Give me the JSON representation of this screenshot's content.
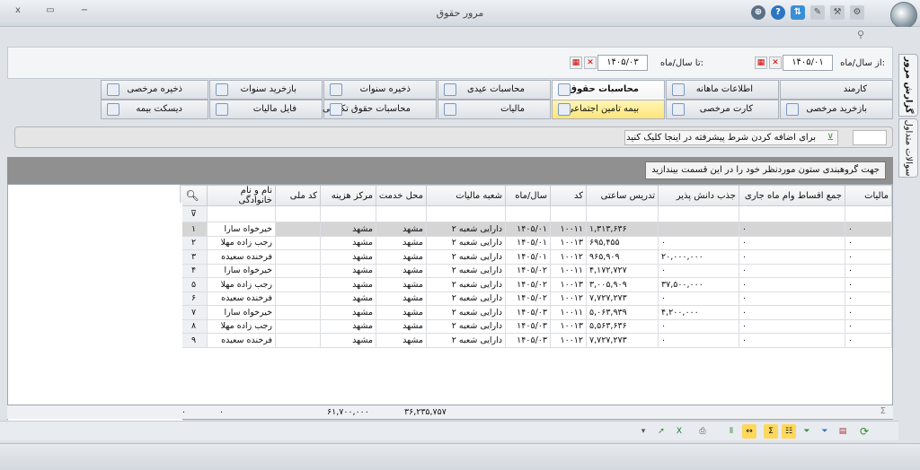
{
  "window": {
    "title": "مرور حقوق",
    "close_glyph": "x",
    "restore_glyph": "▭",
    "minimize_glyph": "−"
  },
  "filter": {
    "from_label": "از سال/ماه:",
    "from_value": "۱۴۰۵/۰۱",
    "to_label": "تا سال/ماه:",
    "to_value": "۱۴۰۵/۰۳"
  },
  "tabs_row1": [
    {
      "label": "کارمند"
    },
    {
      "label": "اطلاعات ماهانه"
    },
    {
      "label": "محاسبات حقوق"
    },
    {
      "label": "محاسبات عیدی"
    },
    {
      "label": "ذخیره سنوات"
    },
    {
      "label": "بازخرید سنوات"
    },
    {
      "label": "ذخیره مرخصی"
    }
  ],
  "tabs_row2": [
    {
      "label": "بازخرید مرخصی"
    },
    {
      "label": "کارت مرخصی"
    },
    {
      "label": "بیمه تامین اجتماعی"
    },
    {
      "label": "مالیات"
    },
    {
      "label": "محاسبات حقوق تکمیلی"
    },
    {
      "label": "فایل مالیات"
    },
    {
      "label": "دیسکت بیمه"
    }
  ],
  "side_tabs": {
    "report": "گزارش مرور",
    "queries": "سوالات متداول"
  },
  "condition_bar": {
    "text": "برای اضافه کردن شرط پیشرفته در اینجا کلیک کنید"
  },
  "group_panel": {
    "text": "جهت گروهبندی ستون موردنظر خود را در این قسمت بیندازید"
  },
  "grid": {
    "columns": [
      "نام و نام خانوادگی",
      "کد ملی",
      "مرکز هزینه",
      "محل خدمت",
      "شعبه مالیات",
      "سال/ماه",
      "کد",
      "تدریس ساعتی",
      "جذب دانش پذیر",
      "جمع اقساط وام ماه جاری",
      "مالیات"
    ],
    "rows": [
      {
        "n": "۱",
        "name": "خیرخواه سارا",
        "natcode": "",
        "cost_center": "مشهد",
        "location": "مشهد",
        "tax_branch": "دارایی شعبه ۲",
        "period": "۱۴۰۵/۰۱",
        "code": "۱۰۰۱۱",
        "teaching": "۱,۳۱۳,۶۳۶",
        "attract": "",
        "loans": "۰",
        "tax": "۰"
      },
      {
        "n": "۲",
        "name": "رجب زاده مهلا",
        "natcode": "",
        "cost_center": "مشهد",
        "location": "مشهد",
        "tax_branch": "دارایی شعبه ۲",
        "period": "۱۴۰۵/۰۱",
        "code": "۱۰۰۱۳",
        "teaching": "۶۹۵,۴۵۵",
        "attract": "۰",
        "loans": "۰",
        "tax": "۰"
      },
      {
        "n": "۳",
        "name": "فرخنده سعیده",
        "natcode": "",
        "cost_center": "مشهد",
        "location": "مشهد",
        "tax_branch": "دارایی شعبه ۲",
        "period": "۱۴۰۵/۰۱",
        "code": "۱۰۰۱۲",
        "teaching": "۹۶۵,۹۰۹",
        "attract": "۲۰,۰۰۰,۰۰۰",
        "loans": "۰",
        "tax": "۰"
      },
      {
        "n": "۴",
        "name": "خیرخواه سارا",
        "natcode": "",
        "cost_center": "مشهد",
        "location": "مشهد",
        "tax_branch": "دارایی شعبه ۲",
        "period": "۱۴۰۵/۰۲",
        "code": "۱۰۰۱۱",
        "teaching": "۴,۱۷۲,۷۲۷",
        "attract": "۰",
        "loans": "۰",
        "tax": "۰"
      },
      {
        "n": "۵",
        "name": "رجب زاده مهلا",
        "natcode": "",
        "cost_center": "مشهد",
        "location": "مشهد",
        "tax_branch": "دارایی شعبه ۲",
        "period": "۱۴۰۵/۰۲",
        "code": "۱۰۰۱۳",
        "teaching": "۳,۰۰۵,۹۰۹",
        "attract": "۳۷,۵۰۰,۰۰۰",
        "loans": "۰",
        "tax": "۰"
      },
      {
        "n": "۶",
        "name": "فرخنده سعیده",
        "natcode": "",
        "cost_center": "مشهد",
        "location": "مشهد",
        "tax_branch": "دارایی شعبه ۲",
        "period": "۱۴۰۵/۰۲",
        "code": "۱۰۰۱۲",
        "teaching": "۷,۷۲۷,۲۷۳",
        "attract": "۰",
        "loans": "۰",
        "tax": "۰"
      },
      {
        "n": "۷",
        "name": "خیرخواه سارا",
        "natcode": "",
        "cost_center": "مشهد",
        "location": "مشهد",
        "tax_branch": "دارایی شعبه ۲",
        "period": "۱۴۰۵/۰۳",
        "code": "۱۰۰۱۱",
        "teaching": "۵,۰۶۳,۹۳۹",
        "attract": "۴,۲۰۰,۰۰۰",
        "loans": "۰",
        "tax": "۰"
      },
      {
        "n": "۸",
        "name": "رجب زاده مهلا",
        "natcode": "",
        "cost_center": "مشهد",
        "location": "مشهد",
        "tax_branch": "دارایی شعبه ۲",
        "period": "۱۴۰۵/۰۳",
        "code": "۱۰۰۱۳",
        "teaching": "۵,۵۶۳,۶۳۶",
        "attract": "۰",
        "loans": "۰",
        "tax": "۰"
      },
      {
        "n": "۹",
        "name": "فرخنده سعیده",
        "natcode": "",
        "cost_center": "مشهد",
        "location": "مشهد",
        "tax_branch": "دارایی شعبه ۲",
        "period": "۱۴۰۵/۰۳",
        "code": "۱۰۰۱۲",
        "teaching": "۷,۷۲۷,۲۷۳",
        "attract": "۰",
        "loans": "۰",
        "tax": "۰"
      }
    ],
    "totals": {
      "teaching": "۳۶,۲۳۵,۷۵۷",
      "attract": "۶۱,۷۰۰,۰۰۰",
      "loans": "۰",
      "tax": "۰"
    }
  },
  "colors": {
    "accent": "#ffe57a",
    "header_bg": "#dfe3e8",
    "group_bg": "#909090"
  }
}
